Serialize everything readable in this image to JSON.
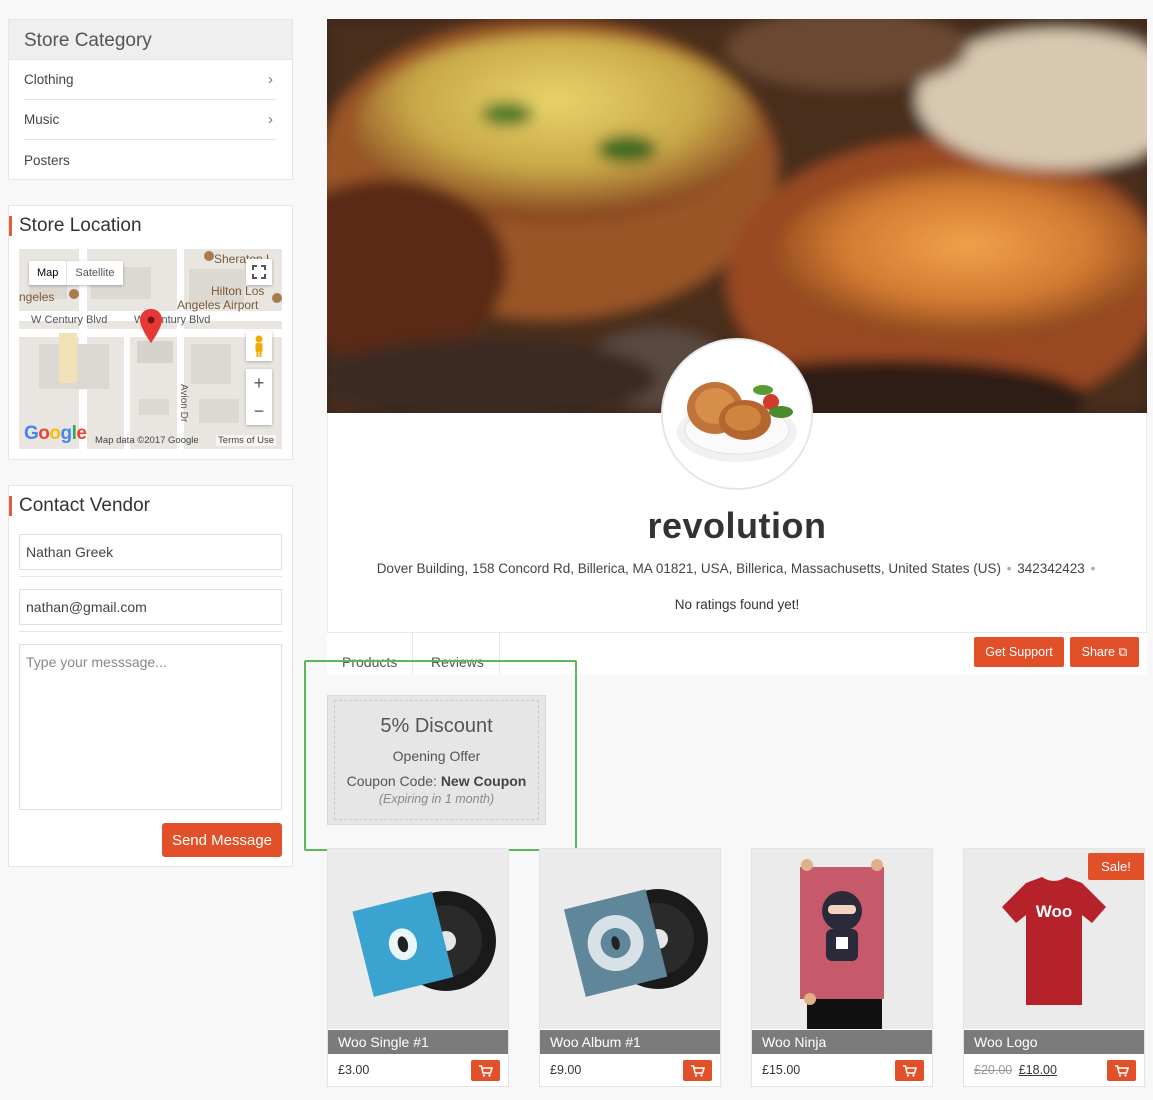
{
  "sidebar": {
    "category": {
      "title": "Store Category",
      "items": [
        {
          "label": "Clothing",
          "has_children": true
        },
        {
          "label": "Music",
          "has_children": true
        },
        {
          "label": "Posters",
          "has_children": false
        }
      ]
    },
    "location": {
      "title": "Store Location",
      "map": {
        "type_map": "Map",
        "type_satellite": "Satellite",
        "street1": "W Century Blvd",
        "street2": "W Century Blvd",
        "street3": "Avion Dr",
        "poi1": "Hilton Los",
        "poi2": "Angeles Airport",
        "poi3": "Sheraton L",
        "poi4": "ngeles",
        "google": "Google",
        "attribution": "Map data ©2017 Google",
        "terms": "Terms of Use"
      }
    },
    "contact": {
      "title": "Contact Vendor",
      "name_value": "Nathan Greek",
      "email_value": "nathan@gmail.com",
      "message_placeholder": "Type your messsage...",
      "send_label": "Send Message"
    }
  },
  "store": {
    "name": "revolution",
    "address": "Dover Building, 158 Concord Rd, Billerica, MA 01821, USA, Billerica, Massachusetts, United States (US)",
    "phone": "342342423",
    "ratings": "No ratings found yet!",
    "tabs": [
      {
        "label": "Products"
      },
      {
        "label": "Reviews"
      }
    ],
    "get_support_label": "Get Support",
    "share_label": "Share"
  },
  "coupon": {
    "amount": "5% Discount",
    "title": "Opening Offer",
    "code_label": "Coupon Code:",
    "code": "New Coupon",
    "expiry": "(Expiring in 1 month)"
  },
  "products": [
    {
      "title": "Woo Single #1",
      "price": "£3.00",
      "sale": false
    },
    {
      "title": "Woo Album #1",
      "price": "£9.00",
      "sale": false
    },
    {
      "title": "Woo Ninja",
      "price": "£15.00",
      "sale": false
    },
    {
      "title": "Woo Logo",
      "old_price": "£20.00",
      "price": "£18.00",
      "sale": true,
      "sale_label": "Sale!",
      "woo_text": "Woo"
    }
  ],
  "colors": {
    "accent": "#e2502a",
    "highlight": "#5cb85c"
  }
}
